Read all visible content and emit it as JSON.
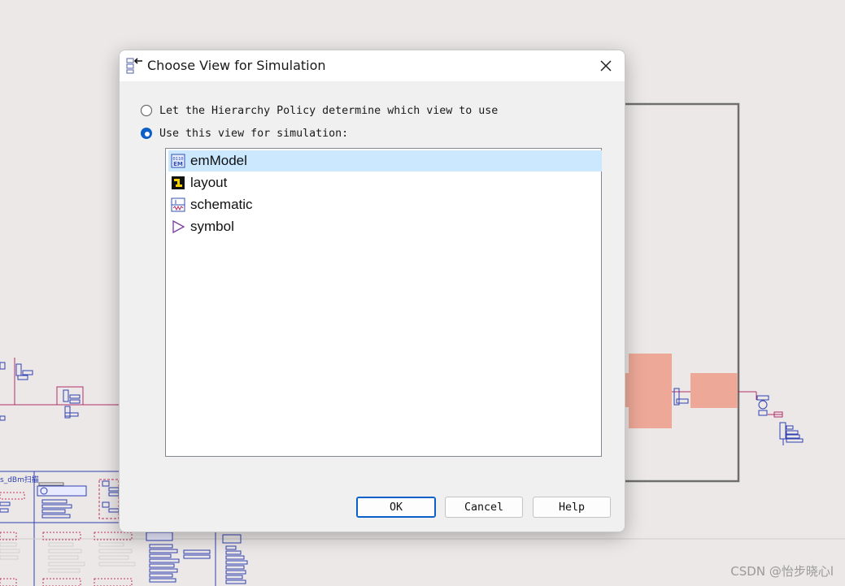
{
  "dialog": {
    "title": "Choose View for Simulation",
    "options": [
      {
        "label": "Let the Hierarchy Policy determine which view to use",
        "checked": false
      },
      {
        "label": "Use this view for simulation:",
        "checked": true
      }
    ],
    "views": [
      {
        "label": "emModel",
        "icon": "em-model-icon",
        "selected": true
      },
      {
        "label": "layout",
        "icon": "layout-icon",
        "selected": false
      },
      {
        "label": "schematic",
        "icon": "schematic-icon",
        "selected": false
      },
      {
        "label": "symbol",
        "icon": "symbol-icon",
        "selected": false
      }
    ],
    "buttons": {
      "ok": "OK",
      "cancel": "Cancel",
      "help": "Help"
    }
  },
  "background": {
    "annotation_label": "s_dBm扫描",
    "watermark": "CSDN @怡步晓心l"
  },
  "colors": {
    "accent": "#0b5fc8",
    "selection": "#cce8ff",
    "wire": "#b0306a",
    "component": "#3040b0",
    "highlight": "#eea898"
  }
}
